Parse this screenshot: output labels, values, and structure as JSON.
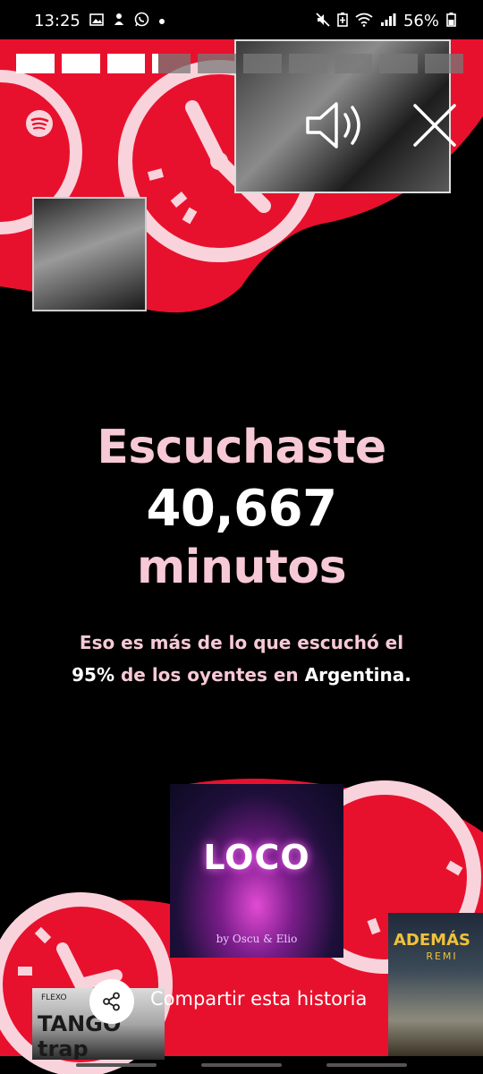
{
  "status_bar": {
    "time": "13:25",
    "battery": "56%",
    "left_icons": [
      "gallery-icon",
      "bug-icon",
      "whatsapp-icon",
      "dot-icon"
    ],
    "right_icons": [
      "mute-icon",
      "battery-saver-icon",
      "wifi-icon",
      "signal-icon",
      "battery-icon"
    ]
  },
  "story_progress": {
    "segments": 10,
    "current_index": 3,
    "current_fraction": 0.15
  },
  "covers": {
    "loco": {
      "title": "LOCO",
      "subtitle": "by Oscu & Elio"
    },
    "ademas": {
      "title": "ADEMÁS",
      "subtitle": "REMI"
    },
    "tango": {
      "small": "FLEXO",
      "title": "TANGO trap"
    }
  },
  "headline": {
    "line1": "Escuchaste",
    "minutes": "40,667",
    "line3": "minutos"
  },
  "comparison": {
    "part1": "Eso es más de lo que escuchó el",
    "percent": "95%",
    "part2": "de los oyentes en",
    "country": "Argentina."
  },
  "share": {
    "label": "Compartir esta historia"
  },
  "colors": {
    "accent_red": "#e8112d",
    "pink": "#f7c9d6",
    "light_pink": "#f9d3dc"
  }
}
